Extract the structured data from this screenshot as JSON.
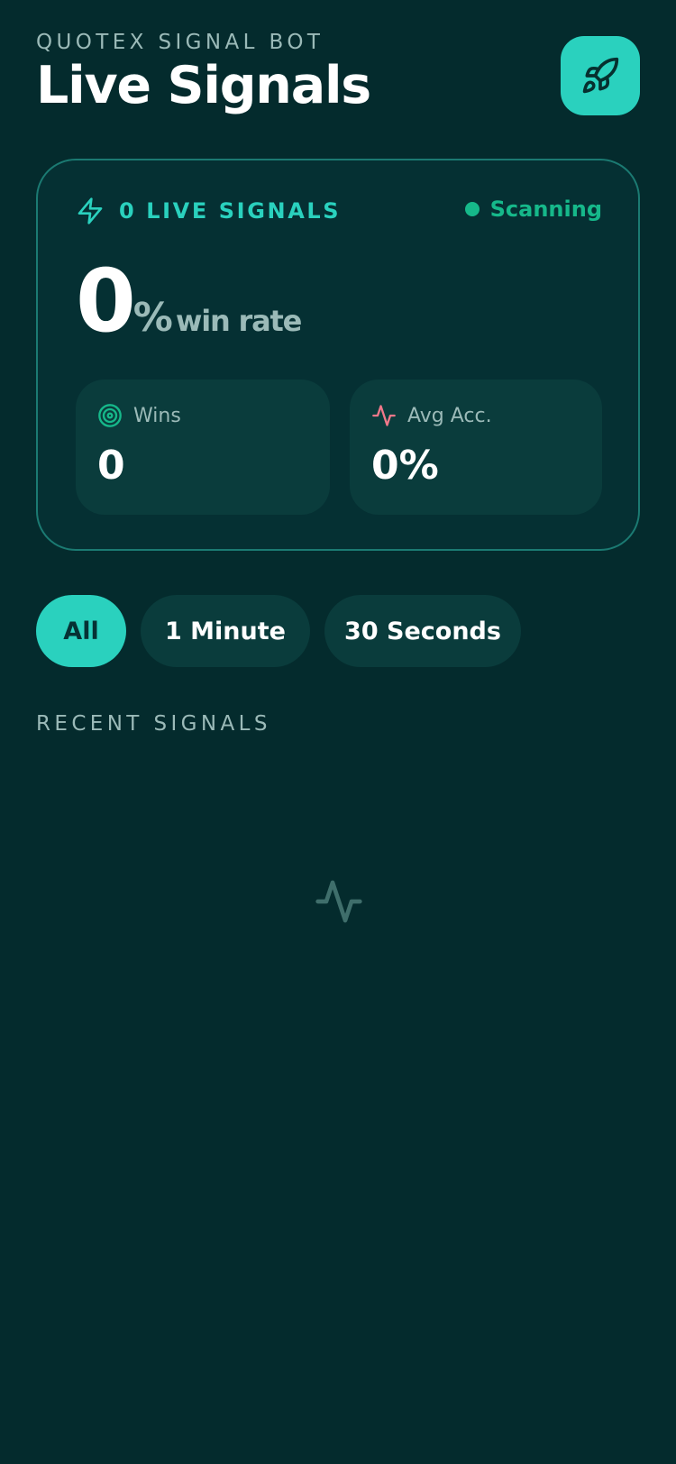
{
  "header": {
    "subtitle": "QUOTEX SIGNAL BOT",
    "title": "Live Signals",
    "action_icon": "rocket-icon"
  },
  "stats": {
    "live_label": "0 LIVE SIGNALS",
    "live_icon": "lightning-icon",
    "status": "Scanning",
    "win_rate_value": "0",
    "win_rate_unit": "%",
    "win_rate_label": "win rate",
    "wins": {
      "icon": "target-icon",
      "label": "Wins",
      "value": "0"
    },
    "avg_acc": {
      "icon": "activity-icon",
      "label": "Avg Acc.",
      "value": "0%"
    }
  },
  "filters": [
    {
      "label": "All",
      "active": true
    },
    {
      "label": "1 Minute",
      "active": false
    },
    {
      "label": "30 Seconds",
      "active": false
    }
  ],
  "recent": {
    "title": "RECENT SIGNALS",
    "empty_icon": "activity-icon"
  },
  "colors": {
    "background": "#042b2d",
    "card": "#053033",
    "card_border": "#1b7a72",
    "accent": "#2ad1be",
    "status_green": "#16b88a",
    "muted_text": "#9bbab8",
    "pill_bg": "#0a3c3c",
    "acc_icon": "#f0788a"
  }
}
